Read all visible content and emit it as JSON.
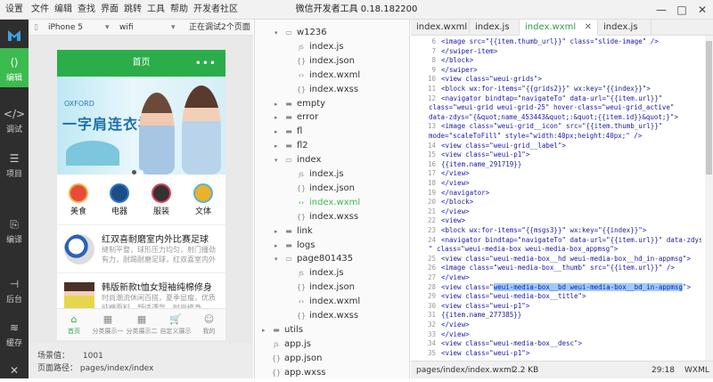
{
  "menubar": {
    "items": [
      "设置",
      "文件",
      "编辑",
      "查找",
      "界面",
      "跳转",
      "工具",
      "帮助",
      "开发者社区"
    ],
    "title": "微信开发者工具 0.18.182200",
    "minimize": "—",
    "maximize": "□",
    "close": "✕"
  },
  "sidebar": {
    "items": [
      {
        "label": "编辑",
        "icon": "code-box-icon"
      },
      {
        "label": "调试",
        "icon": "angle-brackets-icon"
      },
      {
        "label": "项目",
        "icon": "menu-lines-icon"
      },
      {
        "label": "编译",
        "icon": "compile-icon"
      },
      {
        "label": "后台",
        "icon": "background-icon"
      },
      {
        "label": "缓存",
        "icon": "layers-icon"
      }
    ],
    "close_glyph": "✕"
  },
  "simulator": {
    "device": "iPhone 5",
    "network": "wifi",
    "debug_label": "正在调试2个页面",
    "page_title": "首页",
    "menu_dots": "•••",
    "banner_en": "OXFORD",
    "banner_cn": "一字肩连衣裙",
    "grid": [
      {
        "label": "美食",
        "color": "#e84b3c"
      },
      {
        "label": "电器",
        "color": "#2a79c9"
      },
      {
        "label": "服装",
        "color": "#e04060"
      },
      {
        "label": "文体",
        "color": "#e8b22a"
      }
    ],
    "news": [
      {
        "title": "红双喜耐磨室内外比赛足球",
        "desc": "缝制平整，球形压力均匀，射门播劲有力，耐踢耐磨足球，红双喜室内外比赛"
      },
      {
        "title": "韩版新款t恤女短袖纯棉修身",
        "desc": "时尚潮流休闲百搭，夏季显瘦，优质纯棉面料，舒适透气，时尚修身"
      }
    ],
    "tabs": [
      {
        "label": "首页",
        "icon": "⌂"
      },
      {
        "label": "分类展示一",
        "icon": "▦"
      },
      {
        "label": "分类展示二",
        "icon": "▦"
      },
      {
        "label": "自定义展示",
        "icon": "🛒"
      },
      {
        "label": "我的",
        "icon": "☺"
      }
    ],
    "scene_label": "场景值：",
    "scene_value": "1001",
    "path_label": "页面路径：",
    "path_value": "pages/index/index"
  },
  "filetree": {
    "rows": [
      {
        "name": "w1236",
        "type": "folder-open",
        "depth": 0
      },
      {
        "name": "index.js",
        "type": "js",
        "depth": 1
      },
      {
        "name": "index.json",
        "type": "json",
        "depth": 1
      },
      {
        "name": "index.wxml",
        "type": "wxml",
        "depth": 1
      },
      {
        "name": "index.wxss",
        "type": "wxss",
        "depth": 1
      },
      {
        "name": "empty",
        "type": "folder",
        "depth": 0
      },
      {
        "name": "error",
        "type": "folder",
        "depth": 0
      },
      {
        "name": "fl",
        "type": "folder",
        "depth": 0
      },
      {
        "name": "fl2",
        "type": "folder",
        "depth": 0
      },
      {
        "name": "index",
        "type": "folder-open",
        "depth": 0
      },
      {
        "name": "index.js",
        "type": "js",
        "depth": 1
      },
      {
        "name": "index.json",
        "type": "json",
        "depth": 1
      },
      {
        "name": "index.wxml",
        "type": "wxml",
        "depth": 1,
        "active": true
      },
      {
        "name": "index.wxss",
        "type": "wxss",
        "depth": 1
      },
      {
        "name": "link",
        "type": "folder",
        "depth": 0
      },
      {
        "name": "logs",
        "type": "folder",
        "depth": 0
      },
      {
        "name": "page801435",
        "type": "folder-open",
        "depth": 0
      },
      {
        "name": "index.js",
        "type": "js",
        "depth": 1
      },
      {
        "name": "index.json",
        "type": "json",
        "depth": 1
      },
      {
        "name": "index.wxml",
        "type": "wxml",
        "depth": 1
      },
      {
        "name": "index.wxss",
        "type": "wxss",
        "depth": 1
      },
      {
        "name": "utils",
        "type": "folder",
        "depth": -1
      },
      {
        "name": "app.js",
        "type": "js",
        "depth": -1
      },
      {
        "name": "app.json",
        "type": "json",
        "depth": -1
      },
      {
        "name": "app.wxss",
        "type": "wxss",
        "depth": -1
      }
    ]
  },
  "editor": {
    "tabs": [
      {
        "label": "index.wxml",
        "active": false
      },
      {
        "label": "index.js",
        "active": false
      },
      {
        "label": "index.wxml",
        "active": true
      },
      {
        "label": "index.js",
        "active": false
      }
    ],
    "tab_close": "✕",
    "lines": [
      {
        "n": "6",
        "text": "      <image src=\"{{item.thumb_url}}\" class=\"slide-image\" />"
      },
      {
        "n": "7",
        "text": "      </swiper-item>"
      },
      {
        "n": "8",
        "text": "    </block>"
      },
      {
        "n": "9",
        "text": "  </swiper>"
      },
      {
        "n": "10",
        "text": "  <view class=\"weui-grids\">"
      },
      {
        "n": "11",
        "text": "    <block wx:for-items=\"{{grids2}}\" wx:key=\"{{index}}\">"
      },
      {
        "n": "12",
        "text": "      <navigator bindtap=\"navigateTo\" data-url=\"{{item.url}}\""
      },
      {
        "n": "",
        "text": "class=\"weui-grid weui-grid-25\" hover-class=\"weui-grid_active\""
      },
      {
        "n": "",
        "text": "data-zdys=\"{&quot;name_453443&quot;:&quot;{{item.id}}&quot;}\">"
      },
      {
        "n": "13",
        "text": "        <image class=\"weui-grid__icon\" src=\"{{item.thumb_url}}\""
      },
      {
        "n": "",
        "text": "mode=\"scaleToFill\" style=\"width:40px;height:40px;\" />"
      },
      {
        "n": "14",
        "text": "        <view class=\"weui-grid__label\">"
      },
      {
        "n": "15",
        "text": "          <view class=\"weui-p1\">"
      },
      {
        "n": "16",
        "text": "            {{item.name_291719}}"
      },
      {
        "n": "17",
        "text": "          </view>"
      },
      {
        "n": "18",
        "text": "        </view>"
      },
      {
        "n": "19",
        "text": "      </navigator>"
      },
      {
        "n": "20",
        "text": "    </block>"
      },
      {
        "n": "21",
        "text": "  </view>"
      },
      {
        "n": "22",
        "text": "  <view>"
      },
      {
        "n": "23",
        "text": "    <block wx:for-items=\"{{msgs3}}\" wx:key=\"{{index}}\">"
      },
      {
        "n": "24",
        "text": "      <navigator bindtap=\"navigateTo\" data-url=\"{{item.url}}\" data-zdys=\"{"
      },
      {
        "n": "",
        "text": "\" class=\"weui-media-box weui-media-box_appmsg\">"
      },
      {
        "n": "25",
        "text": "        <view class=\"weui-media-box__hd weui-media-box__hd_in-appmsg\">"
      },
      {
        "n": "26",
        "text": "          <image class=\"weui-media-box__thumb\" src=\"{{item.url}}\" />"
      },
      {
        "n": "27",
        "text": "        </view>"
      },
      {
        "n": "28",
        "text": "        <view class=\"weui-media-box__bd weui-media-box__bd_in-appmsg\">",
        "highlight": "weui-media-box__bd weui-media-box__bd_in-appmsg"
      },
      {
        "n": "29",
        "text": "          <view class=\"weui-media-box__title\">"
      },
      {
        "n": "30",
        "text": "            <view class=\"weui-p1\">"
      },
      {
        "n": "31",
        "text": "              {{item.name_277385}}"
      },
      {
        "n": "32",
        "text": "            </view>"
      },
      {
        "n": "33",
        "text": "          </view>"
      },
      {
        "n": "34",
        "text": "          <view class=\"weui-media-box__desc\">"
      },
      {
        "n": "35",
        "text": "            <view class=\"weui-p1\">"
      }
    ]
  },
  "statusbar": {
    "path": "pages/index/index.wxml",
    "size": "2.2 KB",
    "cursor": "29:18",
    "lang": "WXML"
  }
}
